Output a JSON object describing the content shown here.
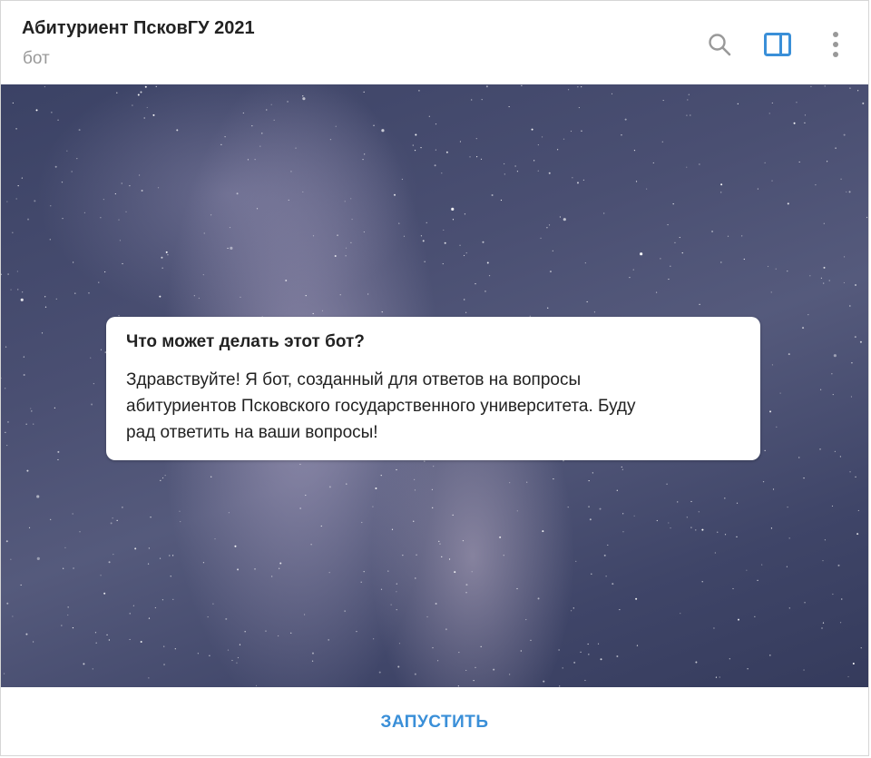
{
  "header": {
    "title": "Абитуриент ПсковГУ 2021",
    "status": "бот",
    "icons": [
      "search-icon",
      "sidebar-toggle-icon",
      "more-vertical-icon"
    ]
  },
  "colors": {
    "accent": "#3a8fd8",
    "title_text": "#222222",
    "muted_text": "#999999"
  },
  "bot_info": {
    "title": "Что может делать этот бот?",
    "line1": "Здравствуйте! Я бот, созданный для ответов на вопросы",
    "line2": "абитуриентов Псковского государственного университета. Буду",
    "line3": "рад ответить на ваши вопросы!"
  },
  "footer": {
    "start_label": "ЗАПУСТИТЬ"
  }
}
